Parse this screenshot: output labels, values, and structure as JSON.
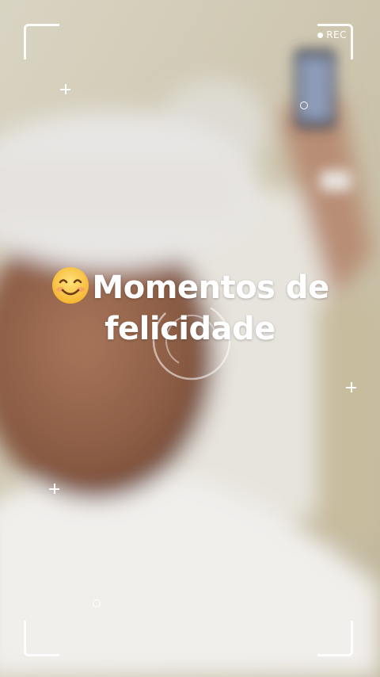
{
  "rec_label": "REC",
  "caption": {
    "emoji": "smiling-face-icon",
    "line1": "Momentos de",
    "line2": "felicidade"
  }
}
